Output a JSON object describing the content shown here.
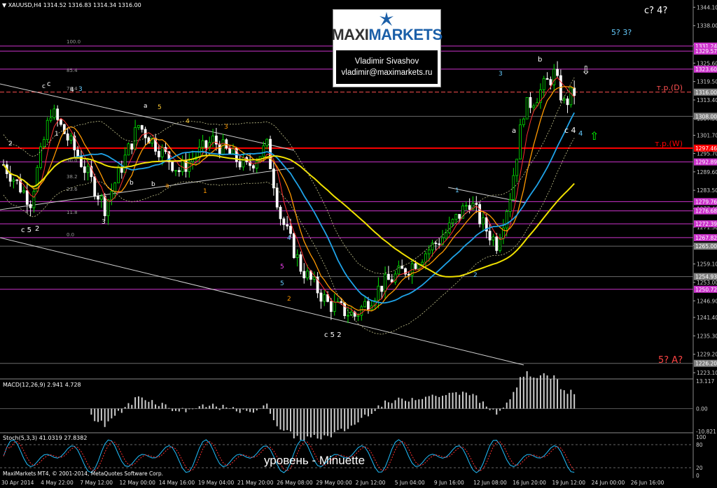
{
  "header": {
    "symbol_line": "XAUUSD,H4  1314.52 1316.83 1314.34 1316.00",
    "macd_label": "MACD(12,26,9) 2.941 4.728",
    "stoch_label": "Stoch(5,3,3) 41.0319 27.8382",
    "copyright": "MaxiMarkets MT4, © 2001-2014, MetaQuotes Software Corp."
  },
  "logo": {
    "brand_a": "MAXI",
    "brand_b": "MARKETS",
    "author": "Vladimir Sivashov",
    "email": "vladimir@maximarkets.ru"
  },
  "watermark": "уровень - Minuette",
  "colors": {
    "background": "#000000",
    "candle_up": "#00e000",
    "candle_down": "#ffffff",
    "ma_fast": "#ff3030",
    "ma_mid": "#ff9900",
    "ma_slow": "#1fa3e8",
    "ma_long": "#f0e000",
    "bands": "#c8c890",
    "channel": "#cfcfcf",
    "level_red": "#ff0000",
    "level_magenta": "#cc33cc",
    "price_axis_text": "#cccccc"
  },
  "chart_data": {
    "type": "candlestick",
    "symbol": "XAUUSD",
    "timeframe": "H4",
    "y_axis": {
      "range": [
        1221.5,
        1346.5
      ],
      "ticks": [
        1344.1,
        1338.0,
        1331.7,
        1325.6,
        1319.5,
        1313.4,
        1307.3,
        1301.7,
        1295.7,
        1289.6,
        1283.5,
        1277.4,
        1271.3,
        1265.2,
        1259.1,
        1253.0,
        1246.9,
        1241.4,
        1235.3,
        1229.2,
        1223.1
      ]
    },
    "x_axis": {
      "labels": [
        "30 Apr 2014",
        "4 May 22:00",
        "7 May 12:00",
        "12 May 00:00",
        "14 May 16:00",
        "19 May 04:00",
        "21 May 20:00",
        "26 May 08:00",
        "29 May 00:00",
        "2 Jun 12:00",
        "5 Jun 04:00",
        "9 Jun 16:00",
        "12 Jun 08:00",
        "16 Jun 20:00",
        "19 Jun 12:00",
        "24 Jun 00:00",
        "26 Jun 16:00"
      ]
    },
    "price_tags": [
      {
        "value": "1331.24",
        "color": "#cc33cc"
      },
      {
        "value": "1329.57",
        "color": "#cc33cc"
      },
      {
        "value": "1323.60",
        "color": "#cc33cc"
      },
      {
        "value": "1316.00",
        "color": "#808080"
      },
      {
        "value": "1308.00",
        "color": "#808080"
      },
      {
        "value": "1297.46",
        "color": "#ff0000"
      },
      {
        "value": "1292.89",
        "color": "#cc33cc"
      },
      {
        "value": "1279.76",
        "color": "#cc33cc"
      },
      {
        "value": "1276.68",
        "color": "#cc33cc"
      },
      {
        "value": "1272.39",
        "color": "#cc33cc"
      },
      {
        "value": "1267.82",
        "color": "#cc33cc"
      },
      {
        "value": "1265.00",
        "color": "#808080"
      },
      {
        "value": "1254.93",
        "color": "#808080"
      },
      {
        "value": "1250.72",
        "color": "#cc33cc"
      },
      {
        "value": "1226.20",
        "color": "#808080"
      }
    ],
    "levels": [
      {
        "price": 1297.46,
        "label": "т.р.(W)",
        "color": "#ff0000",
        "width": 2
      },
      {
        "price": 1316.0,
        "label": "т.р.(D)",
        "color": "#ff5050",
        "dash": true
      },
      {
        "price": 1308.0,
        "color": "#6a6a6a"
      },
      {
        "price": 1331.24,
        "color": "#cc33cc"
      },
      {
        "price": 1329.57,
        "color": "#cc33cc"
      },
      {
        "price": 1323.6,
        "color": "#cc33cc"
      },
      {
        "price": 1292.89,
        "color": "#cc33cc"
      },
      {
        "price": 1279.76,
        "color": "#cc33cc"
      },
      {
        "price": 1276.68,
        "color": "#cc33cc"
      },
      {
        "price": 1272.39,
        "color": "#cc33cc"
      },
      {
        "price": 1267.82,
        "color": "#cc33cc"
      },
      {
        "price": 1265.0,
        "color": "#6a6a6a"
      },
      {
        "price": 1254.93,
        "color": "#6a6a6a"
      },
      {
        "price": 1250.72,
        "color": "#cc33cc"
      },
      {
        "price": 1226.2,
        "color": "#6a6a6a"
      }
    ],
    "fib_levels": [
      "100.0",
      "85.4",
      "76.4",
      "50.0",
      "38.2",
      "23.6",
      "11.8",
      "0.0"
    ],
    "wave_labels": [
      "c? 4?",
      "5? 3?",
      "5? A?",
      "c 4",
      "2",
      "1",
      "b",
      "a",
      "3",
      "c 5",
      "2",
      "1",
      "4",
      "3",
      "5",
      "b",
      "a",
      "c",
      "4",
      "5",
      "2",
      "3",
      "4",
      "5",
      "c 5 2",
      "1",
      "2",
      "3",
      "a",
      "b",
      "c",
      "4"
    ],
    "macd": {
      "ticks": [
        "13.117",
        "0.00",
        "-10.821"
      ],
      "range": [
        -10.821,
        13.117
      ]
    },
    "stoch": {
      "ticks": [
        "100",
        "80",
        "20",
        "0"
      ],
      "range": [
        0,
        100
      ]
    }
  }
}
